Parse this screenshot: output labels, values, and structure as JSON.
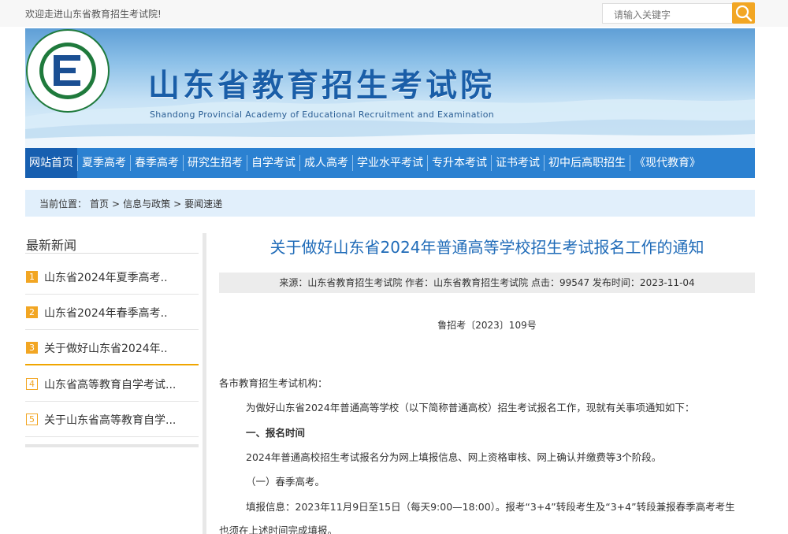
{
  "topbar": {
    "welcome": "欢迎走进山东省教育招生考试院!",
    "search_placeholder": "请输入关键字"
  },
  "colors": {
    "nav_bg": "#2b81d1",
    "nav_active": "#175fb0",
    "accent": "#f2a623",
    "title_blue": "#1f6bb8"
  },
  "banner": {
    "title": "山东省教育招生考试院",
    "subtitle": "Shandong Provincial Academy of Educational Recruitment and Examination"
  },
  "nav": {
    "items": [
      "网站首页",
      "夏季高考",
      "春季高考",
      "研究生招考",
      "自学考试",
      "成人高考",
      "学业水平考试",
      "专升本考试",
      "证书考试",
      "初中后高职招生",
      "《现代教育》"
    ]
  },
  "breadcrumb": {
    "label": "当前位置：",
    "items": [
      "首页",
      ">",
      "信息与政策",
      ">",
      "要闻速递"
    ]
  },
  "sidebar": {
    "title": "最新新闻",
    "items": [
      {
        "num": "1",
        "text": "山东省2024年夏季高考.."
      },
      {
        "num": "2",
        "text": "山东省2024年春季高考.."
      },
      {
        "num": "3",
        "text": "关于做好山东省2024年.."
      },
      {
        "num": "4",
        "text": "山东省高等教育自学考试..."
      },
      {
        "num": "5",
        "text": "关于山东省高等教育自学..."
      }
    ]
  },
  "article": {
    "title": "关于做好山东省2024年普通高等学校招生考试报名工作的通知",
    "meta": "来源：山东省教育招生考试院 作者：山东省教育招生考试院 点击：99547 发布时间：2023-11-04",
    "doc_no": "鲁招考〔2023〕109号",
    "paragraphs": [
      "各市教育招生考试机构：",
      "为做好山东省2024年普通高等学校（以下简称普通高校）招生考试报名工作，现就有关事项通知如下：",
      "一、报名时间",
      "2024年普通高校招生考试报名分为网上填报信息、网上资格审核、网上确认并缴费等3个阶段。",
      "（一）春季高考。",
      "填报信息：2023年11月9日至15日（每天9:00—18:00）。报考“3+4”转段考生及“3+4”转段兼报春季高考考生",
      "也须在上述时间完成填报。"
    ]
  }
}
